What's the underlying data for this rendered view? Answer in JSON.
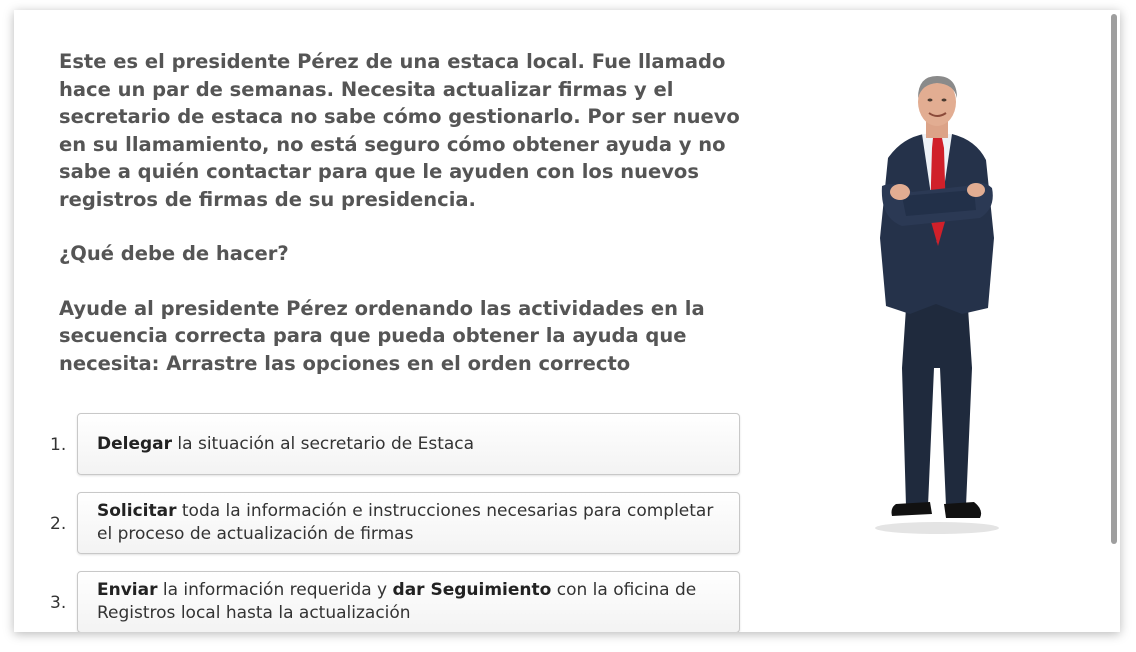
{
  "intro": "Este es el presidente Pérez de una estaca local. Fue llamado hace un par de semanas. Necesita actualizar firmas y el secretario de estaca no sabe cómo gestionarlo. Por ser nuevo en su llamamiento, no está seguro cómo obtener ayuda y no sabe a quién contactar para que le ayuden con los nuevos registros de firmas de su presidencia.",
  "question": "¿Qué debe de hacer?",
  "instructions": "Ayude al presidente Pérez ordenando las actividades en la secuencia correcta para que pueda obtener la ayuda que necesita: Arrastre las opciones en el orden correcto",
  "options": [
    {
      "number": "1.",
      "bold1": "Delegar",
      "text1": " la situación al secretario de Estaca",
      "bold2": "",
      "text2": ""
    },
    {
      "number": "2.",
      "bold1": "Solicitar",
      "text1": " toda la información e instrucciones necesarias para completar el proceso de actualización de firmas",
      "bold2": "",
      "text2": ""
    },
    {
      "number": "3.",
      "bold1": "Enviar",
      "text1": " la información requerida y ",
      "bold2": "dar Seguimiento",
      "text2": " con la oficina de Registros local hasta la actualización"
    }
  ],
  "colors": {
    "suit": "#25324a",
    "tie": "#d0202a",
    "shirt": "#eef2f7"
  }
}
